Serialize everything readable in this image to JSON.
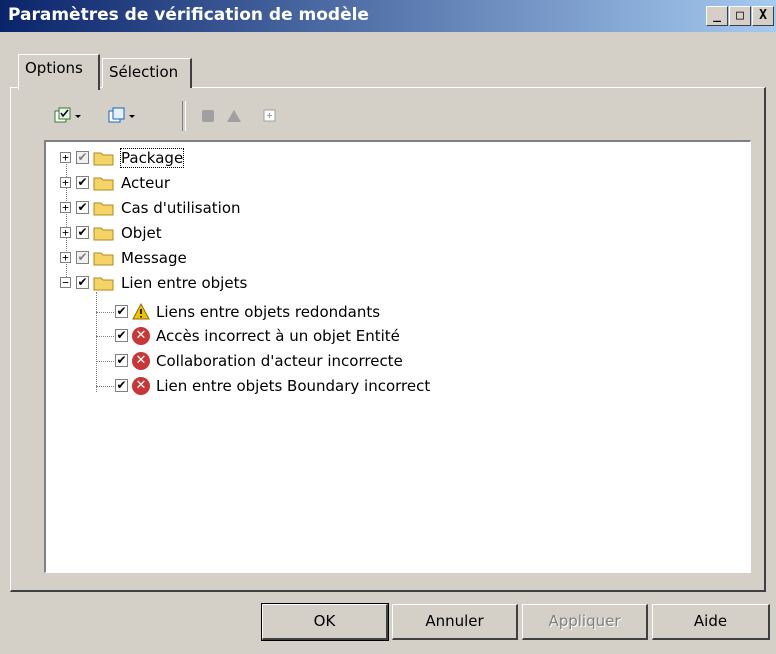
{
  "window": {
    "title": "Paramètres de vérification de modèle"
  },
  "title_buttons": {
    "minimize": "_",
    "maximize": "□",
    "close": "X"
  },
  "tabs": [
    {
      "label": "Options"
    },
    {
      "label": "Sélection"
    }
  ],
  "tree": {
    "items": [
      {
        "label": "Package",
        "check": "partial",
        "expanded": false
      },
      {
        "label": "Acteur",
        "check": "checked",
        "expanded": false
      },
      {
        "label": "Cas d'utilisation",
        "check": "checked",
        "expanded": false
      },
      {
        "label": "Objet",
        "check": "checked",
        "expanded": false
      },
      {
        "label": "Message",
        "check": "partial",
        "expanded": false
      },
      {
        "label": "Lien entre objets",
        "check": "checked",
        "expanded": true,
        "children": [
          {
            "label": "Liens entre objets redondants",
            "icon": "warning-icon"
          },
          {
            "label": "Accès incorrect à un objet Entité",
            "icon": "error-icon"
          },
          {
            "label": "Collaboration d'acteur incorrecte",
            "icon": "error-icon"
          },
          {
            "label": "Lien entre objets Boundary incorrect",
            "icon": "error-icon"
          }
        ]
      }
    ]
  },
  "buttons": {
    "ok": "OK",
    "cancel": "Annuler",
    "apply": "Appliquer",
    "help": "Aide"
  },
  "colors": {
    "titlebar_start": "#0a246a",
    "titlebar_end": "#a6caf0",
    "folder": "#f6d365",
    "error": "#c83737",
    "warning": "#f2c200"
  }
}
